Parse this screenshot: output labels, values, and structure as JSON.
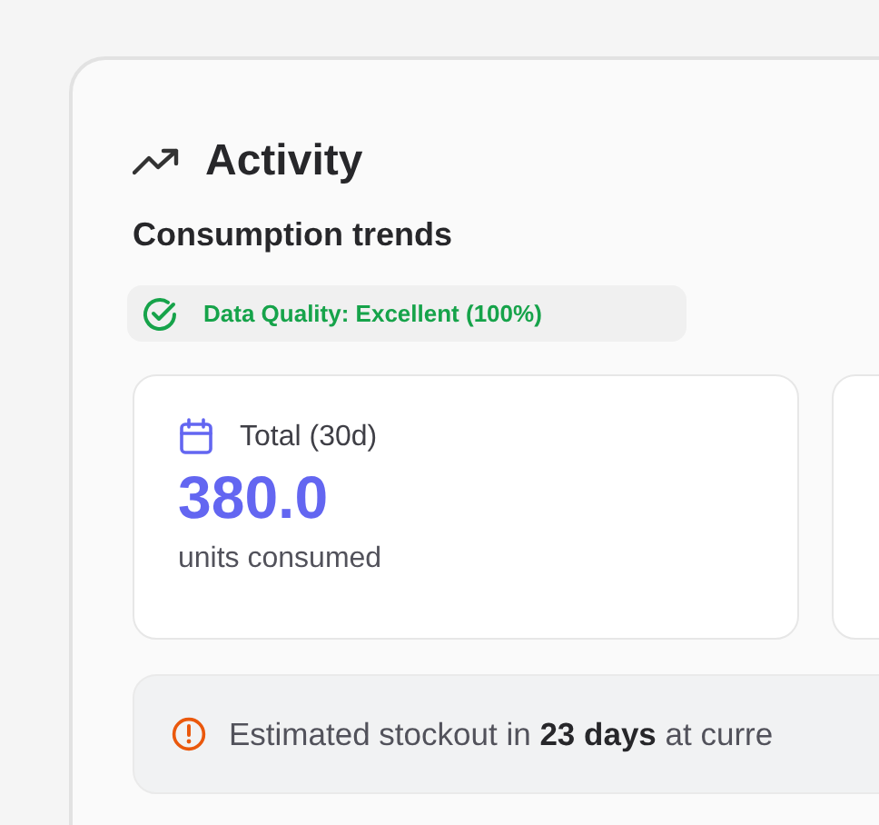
{
  "section": {
    "title": "Activity",
    "subtitle": "Consumption trends"
  },
  "quality_badge": {
    "label": "Data Quality: Excellent (100%)"
  },
  "stats": [
    {
      "kind": "total",
      "label": "Total (30d)",
      "value": "380.0",
      "unit": "units consumed"
    },
    {
      "kind": "clipped"
    }
  ],
  "notice": {
    "text": "Estimated stockout in **23 days** at curre"
  }
}
